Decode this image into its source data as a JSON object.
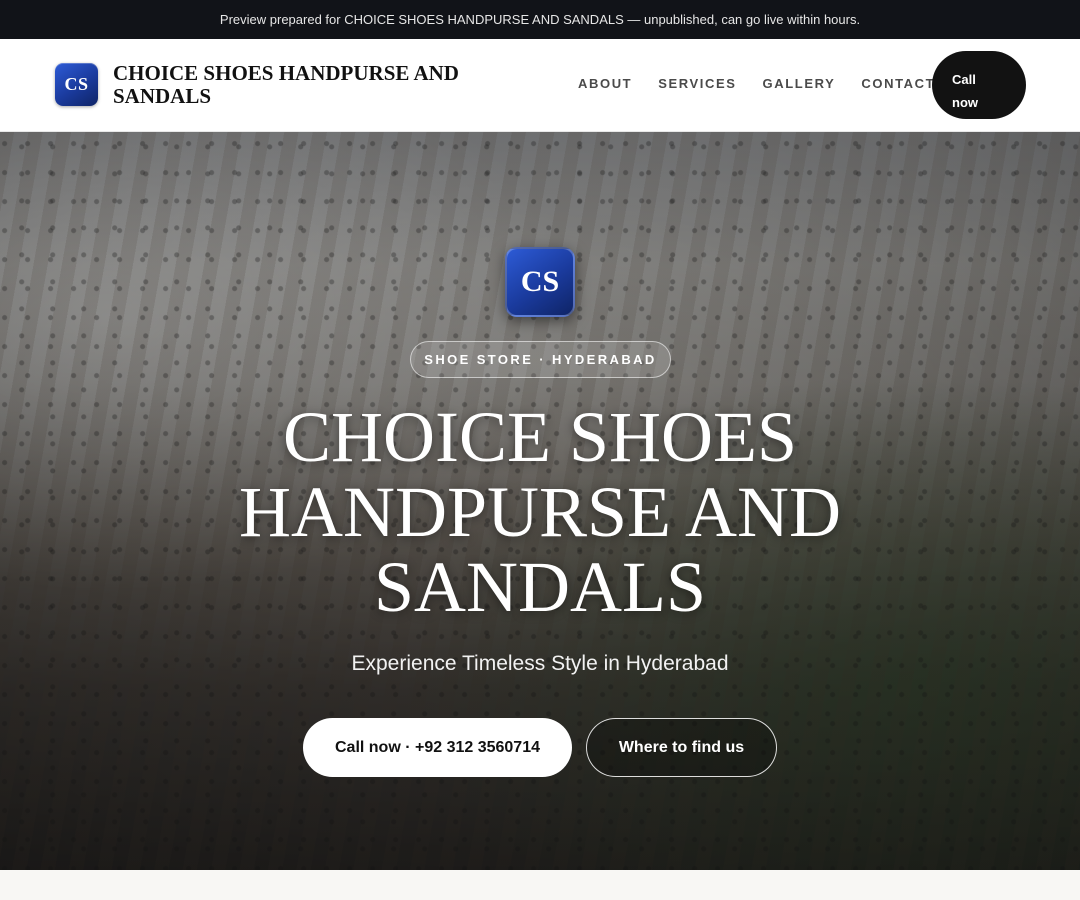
{
  "preview_banner": {
    "text": "Preview prepared for CHOICE SHOES HANDPURSE AND SANDALS — unpublished, can go live within hours."
  },
  "header": {
    "logo_initials": "CS",
    "brand_name": "CHOICE SHOES HANDPURSE AND SANDALS",
    "nav": [
      {
        "label": "ABOUT"
      },
      {
        "label": "SERVICES"
      },
      {
        "label": "GALLERY"
      },
      {
        "label": "CONTACT"
      }
    ],
    "call_label_line1": "Call",
    "call_label_line2": "now"
  },
  "hero": {
    "badge_initials": "CS",
    "eyebrow": "SHOE STORE · HYDERABAD",
    "title": "CHOICE SHOES HANDPURSE AND SANDALS",
    "subtitle": "Experience Timeless Style in Hyderabad",
    "primary_button": "Call now · +92 312 3560714",
    "secondary_button": "Where to find us",
    "background_image": "mall-interior-crowd-photo"
  },
  "colors": {
    "topbar_bg": "#111318",
    "badge_blue": "#1a3a9c",
    "call_button_bg": "#121212",
    "page_bg": "#f8f7f4"
  }
}
